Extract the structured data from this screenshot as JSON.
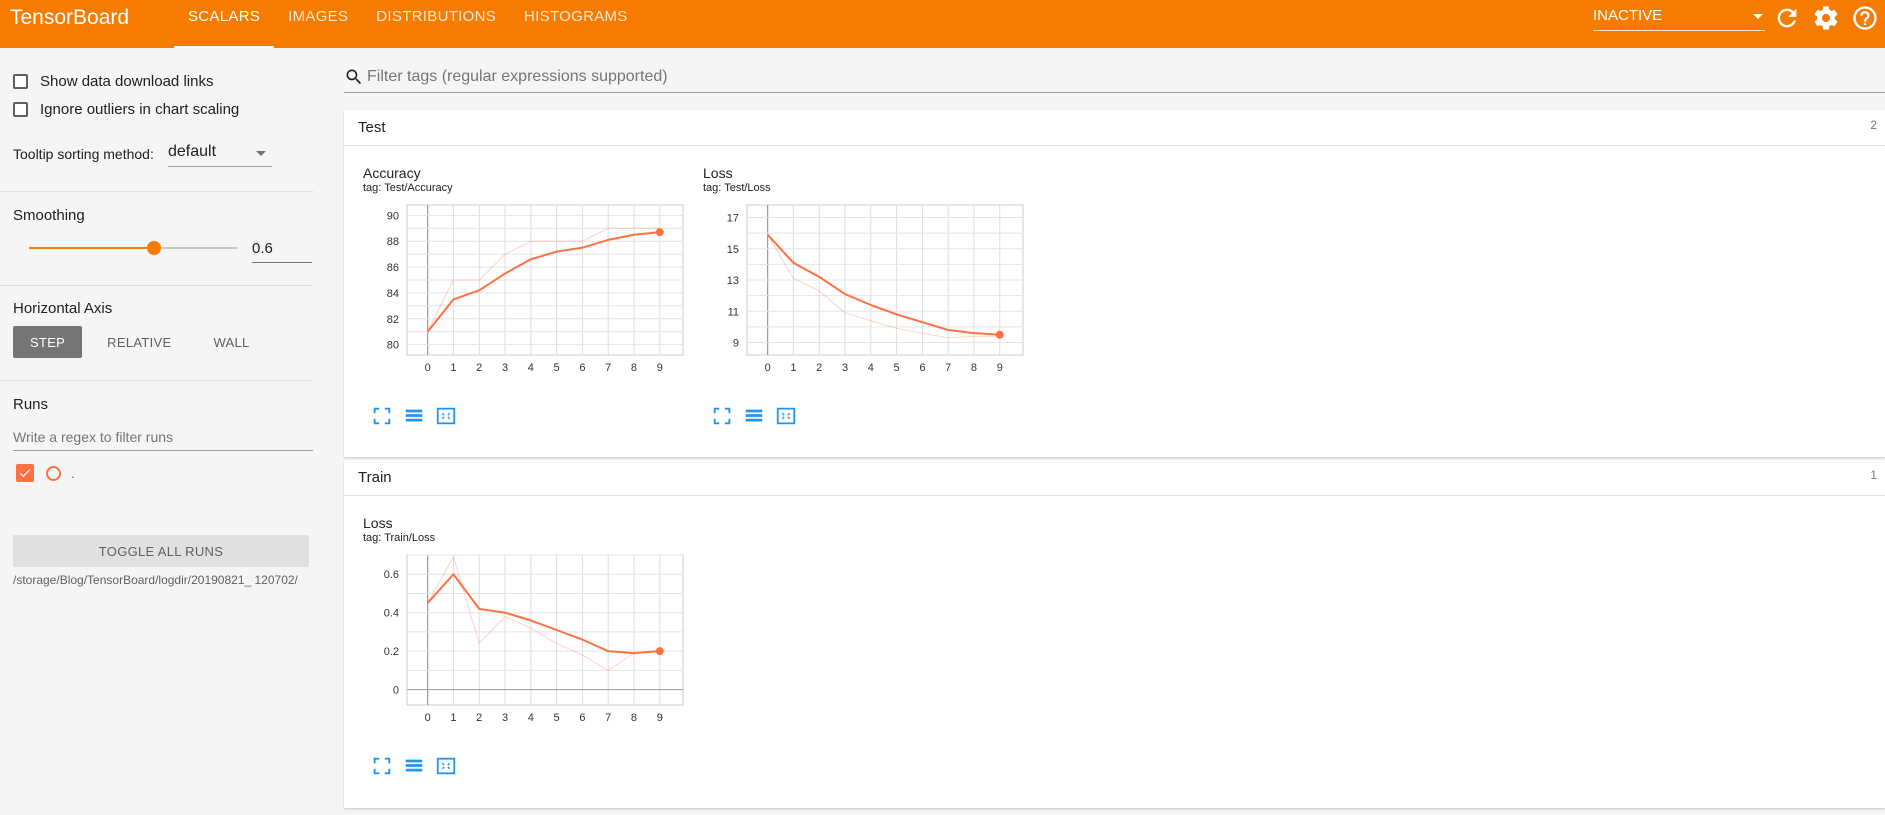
{
  "app": {
    "brand": "TensorBoard",
    "tabs": [
      "SCALARS",
      "IMAGES",
      "DISTRIBUTIONS",
      "HISTOGRAMS"
    ],
    "active_tab": "SCALARS",
    "status_select": "INACTIVE",
    "icons": [
      "refresh-icon",
      "settings-icon",
      "help-icon"
    ],
    "accent_color": "#f57c00",
    "series_color": "#ff7043"
  },
  "sidebar": {
    "show_download_links": "Show data download links",
    "ignore_outliers": "Ignore outliers in chart scaling",
    "tooltip_label": "Tooltip sorting method:",
    "tooltip_value": "default",
    "smoothing_label": "Smoothing",
    "smoothing_value": "0.6",
    "smoothing_level": 0.6,
    "horizontal_axis_label": "Horizontal Axis",
    "axis_buttons": [
      "STEP",
      "RELATIVE",
      "WALL"
    ],
    "axis_active": "STEP",
    "runs_label": "Runs",
    "runs_placeholder": "Write a regex to filter runs",
    "run_name": ".",
    "toggle_all": "TOGGLE ALL RUNS",
    "logdir": "/storage/Blog/TensorBoard/logdir/20190821_ 120702/"
  },
  "main": {
    "filter_placeholder": "Filter tags (regular expressions supported)",
    "groups": [
      {
        "name": "Test",
        "count": "2"
      },
      {
        "name": "Train",
        "count": "1"
      }
    ]
  },
  "chart_data": [
    {
      "type": "line",
      "title": "Accuracy",
      "tag": "tag: Test/Accuracy",
      "x": [
        0,
        1,
        2,
        3,
        4,
        5,
        6,
        7,
        8,
        9
      ],
      "xticks": [
        0,
        1,
        2,
        3,
        4,
        5,
        6,
        7,
        8,
        9
      ],
      "yticks": [
        80,
        82,
        84,
        86,
        88,
        90
      ],
      "ylim": [
        79.2,
        90.8
      ],
      "series": [
        {
          "values": [
            81.0,
            85.0,
            85.0,
            87.0,
            88.0,
            88.0,
            88.0,
            89.0,
            89.0,
            89.0
          ],
          "raw": true
        },
        {
          "values": [
            81.0,
            83.5,
            84.2,
            85.5,
            86.6,
            87.2,
            87.5,
            88.1,
            88.5,
            88.7
          ],
          "raw": false
        }
      ]
    },
    {
      "type": "line",
      "title": "Loss",
      "tag": "tag: Test/Loss",
      "x": [
        0,
        1,
        2,
        3,
        4,
        5,
        6,
        7,
        8,
        9
      ],
      "xticks": [
        0,
        1,
        2,
        3,
        4,
        5,
        6,
        7,
        8,
        9
      ],
      "yticks": [
        9,
        11,
        13,
        15,
        17
      ],
      "ylim": [
        8.2,
        17.8
      ],
      "series": [
        {
          "values": [
            15.9,
            13.1,
            12.3,
            10.9,
            10.4,
            9.9,
            9.6,
            9.3,
            9.4,
            9.4
          ],
          "raw": true
        },
        {
          "values": [
            15.9,
            14.1,
            13.2,
            12.1,
            11.4,
            10.8,
            10.3,
            9.8,
            9.6,
            9.5
          ],
          "raw": false
        }
      ]
    },
    {
      "type": "line",
      "title": "Loss",
      "tag": "tag: Train/Loss",
      "x": [
        0,
        1,
        2,
        3,
        4,
        5,
        6,
        7,
        8,
        9
      ],
      "xticks": [
        0,
        1,
        2,
        3,
        4,
        5,
        6,
        7,
        8,
        9
      ],
      "yticks": [
        0,
        0.2,
        0.4,
        0.6
      ],
      "ylim": [
        -0.08,
        0.7
      ],
      "series": [
        {
          "values": [
            0.45,
            0.69,
            0.24,
            0.38,
            0.32,
            0.24,
            0.18,
            0.1,
            0.19,
            0.2
          ],
          "raw": true
        },
        {
          "values": [
            0.45,
            0.6,
            0.42,
            0.4,
            0.36,
            0.31,
            0.26,
            0.2,
            0.19,
            0.2
          ],
          "raw": false
        }
      ]
    }
  ]
}
